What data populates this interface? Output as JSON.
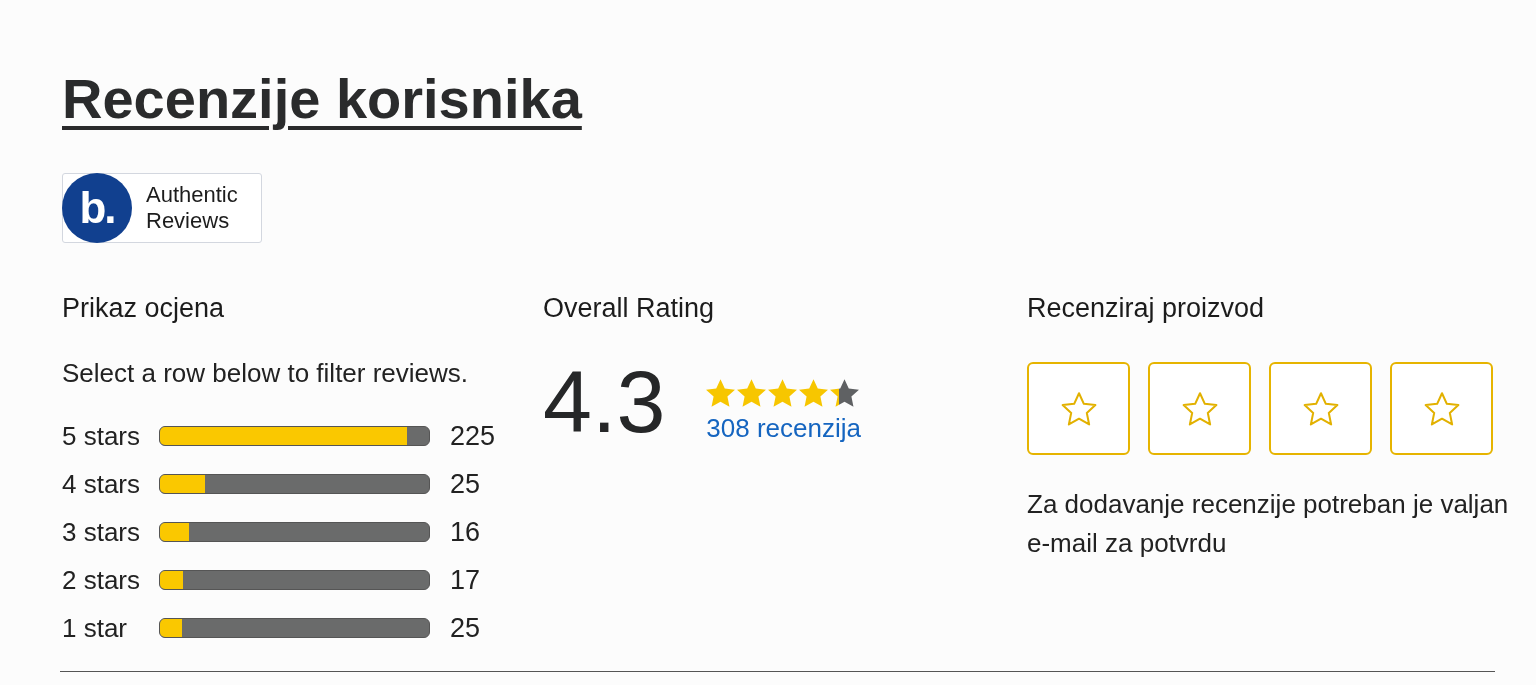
{
  "title": "Recenzije korisnika",
  "badge": {
    "logo": "b.",
    "text": "Authentic Reviews"
  },
  "distribution": {
    "heading": "Prikaz ocjena",
    "hint": "Select a row below to filter reviews.",
    "rows": [
      {
        "label": "5 stars",
        "level": 0.92,
        "count": "225"
      },
      {
        "label": "4 stars",
        "level": 0.166,
        "count": "25"
      },
      {
        "label": "3 stars",
        "level": 0.107,
        "count": "16"
      },
      {
        "label": "2 stars",
        "level": 0.085,
        "count": "17"
      },
      {
        "label": "1 star",
        "level": 0.08,
        "count": "25"
      }
    ]
  },
  "overall": {
    "heading": "Overall Rating",
    "score": "4.3",
    "stars": 4.3,
    "reviews_link": "308 recenzija"
  },
  "write_review": {
    "heading": "Recenziraj proizvod",
    "rate_buttons": [
      {
        "selected": false
      },
      {
        "selected": false
      },
      {
        "selected": false
      },
      {
        "selected": false
      }
    ],
    "note": "Za dodavanje recenzije potreban je valjan e-mail za potvrdu"
  }
}
